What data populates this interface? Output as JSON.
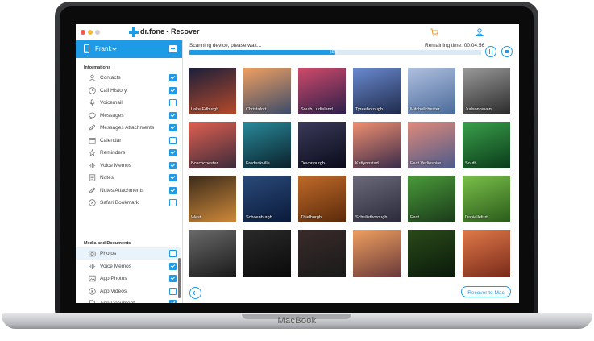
{
  "window": {
    "app_name": "dr.fone",
    "title": "dr.fone - Recover",
    "brand_color": "#1e9be6"
  },
  "device": {
    "name": "Frank",
    "icon": "phone-icon"
  },
  "sidebar": {
    "section_informations": "Informations",
    "section_media": "Media and Documents",
    "info_items": [
      {
        "label": "Contacts",
        "icon": "contact-icon",
        "checked": true
      },
      {
        "label": "Call History",
        "icon": "clock-icon",
        "checked": true
      },
      {
        "label": "Voicemail",
        "icon": "mic-icon",
        "checked": false
      },
      {
        "label": "Messages",
        "icon": "message-icon",
        "checked": true
      },
      {
        "label": "Messages Attachments",
        "icon": "paperclip-icon",
        "checked": true
      },
      {
        "label": "Calendar",
        "icon": "calendar-icon",
        "checked": false
      },
      {
        "label": "Reminders",
        "icon": "reminder-icon",
        "checked": true
      },
      {
        "label": "Voice Memos",
        "icon": "waveform-icon",
        "checked": true
      },
      {
        "label": "Notes",
        "icon": "notes-icon",
        "checked": true
      },
      {
        "label": "Notes Attachments",
        "icon": "paperclip-icon",
        "checked": true
      },
      {
        "label": "Safari Bookmark",
        "icon": "compass-icon",
        "checked": false
      }
    ],
    "media_items": [
      {
        "label": "Photos",
        "icon": "camera-icon",
        "checked": false,
        "selected": true
      },
      {
        "label": "Voice Memos",
        "icon": "waveform-icon",
        "checked": true
      },
      {
        "label": "App Photos",
        "icon": "image-icon",
        "checked": true
      },
      {
        "label": "App Videos",
        "icon": "play-icon",
        "checked": false
      },
      {
        "label": "App Document",
        "icon": "document-icon",
        "checked": true
      }
    ]
  },
  "scan": {
    "status": "Scanning device, please wait...",
    "remaining": "Remaining time: 00:04:56",
    "progress_pct": 50,
    "progress_label": "50%"
  },
  "photos": [
    {
      "caption": "Lake Edburgh",
      "colors": [
        "#1a1f3a",
        "#b84a2a"
      ]
    },
    {
      "caption": "Christafort",
      "colors": [
        "#f0a060",
        "#3a4a6a"
      ]
    },
    {
      "caption": "South Ludieland",
      "colors": [
        "#d04a6a",
        "#2a1f4a"
      ]
    },
    {
      "caption": "Tyreeborough",
      "colors": [
        "#6a8ad0",
        "#1f2a4a"
      ]
    },
    {
      "caption": "Mitchellchester",
      "colors": [
        "#b0c0e0",
        "#4a6a9a"
      ]
    },
    {
      "caption": "Judsonhaven",
      "colors": [
        "#9a9a9a",
        "#2a2a2a"
      ]
    },
    {
      "caption": "Boscochester",
      "colors": [
        "#e06050",
        "#3a2a3a"
      ]
    },
    {
      "caption": "Frederikville",
      "colors": [
        "#2a8a9a",
        "#0a1f2a"
      ]
    },
    {
      "caption": "Devonburgh",
      "colors": [
        "#3a3a5a",
        "#0a0a1a"
      ]
    },
    {
      "caption": "Katlynnstad",
      "colors": [
        "#f09070",
        "#3a2a4a"
      ]
    },
    {
      "caption": "East Verlieshire",
      "colors": [
        "#e08a7a",
        "#4a5a8a"
      ]
    },
    {
      "caption": "South",
      "colors": [
        "#3aa04a",
        "#0a3a1a"
      ]
    },
    {
      "caption": "West",
      "colors": [
        "#3a2a1a",
        "#d08a3a"
      ]
    },
    {
      "caption": "Schoenburgh",
      "colors": [
        "#2a4a7a",
        "#0a1a3a"
      ]
    },
    {
      "caption": "Thielburgh",
      "colors": [
        "#c06a2a",
        "#5a2a0a"
      ]
    },
    {
      "caption": "Schulistborough",
      "colors": [
        "#6a6a7a",
        "#2a2a3a"
      ]
    },
    {
      "caption": "East",
      "colors": [
        "#4a9a3a",
        "#1a3a1a"
      ]
    },
    {
      "caption": "Daniellefurt",
      "colors": [
        "#7ac04a",
        "#2a5a1a"
      ]
    },
    {
      "caption": "",
      "colors": [
        "#6a6a6a",
        "#1a1a1a"
      ]
    },
    {
      "caption": "",
      "colors": [
        "#2a2a2a",
        "#0a0a0a"
      ]
    },
    {
      "caption": "",
      "colors": [
        "#3a2a2a",
        "#1a1a1a"
      ]
    },
    {
      "caption": "",
      "colors": [
        "#f0a060",
        "#6a3a3a"
      ]
    },
    {
      "caption": "",
      "colors": [
        "#2a4a1a",
        "#0a1a0a"
      ]
    },
    {
      "caption": "",
      "colors": [
        "#e07a4a",
        "#7a2a1a"
      ]
    }
  ],
  "actions": {
    "recover_label": "Recover to Mac",
    "back_icon": "arrow-left-icon"
  },
  "frame": {
    "label": "MacBook"
  }
}
